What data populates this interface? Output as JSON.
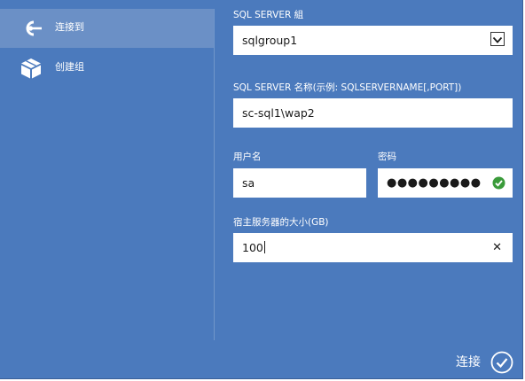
{
  "sidebar": {
    "items": [
      {
        "label": "连接到",
        "icon": "plug-connect-icon",
        "active": true
      },
      {
        "label": "创建组",
        "icon": "cube-icon",
        "active": false
      }
    ]
  },
  "form": {
    "group": {
      "label": "SQL SERVER 組",
      "value": "sqlgroup1",
      "icon": "chevron-down-icon"
    },
    "server_name": {
      "label": "SQL SERVER 名称(示例: SQLSERVERNAME[,PORT])",
      "value": "sc-sql1\\wap2"
    },
    "username": {
      "label": "用户名",
      "value": "sa"
    },
    "password": {
      "label": "密码",
      "masked": "●●●●●●●●●",
      "status_icon": "check-circle-icon"
    },
    "host_size": {
      "label": "宿主服务器的大小(GB)",
      "value": "100",
      "clear_symbol": "✕"
    }
  },
  "footer": {
    "confirm_label": "连接",
    "confirm_icon": "checkmark-circle-icon"
  },
  "colors": {
    "background": "#4b7abd",
    "active_item": "#6b90c6",
    "success": "#3a9b3a"
  }
}
